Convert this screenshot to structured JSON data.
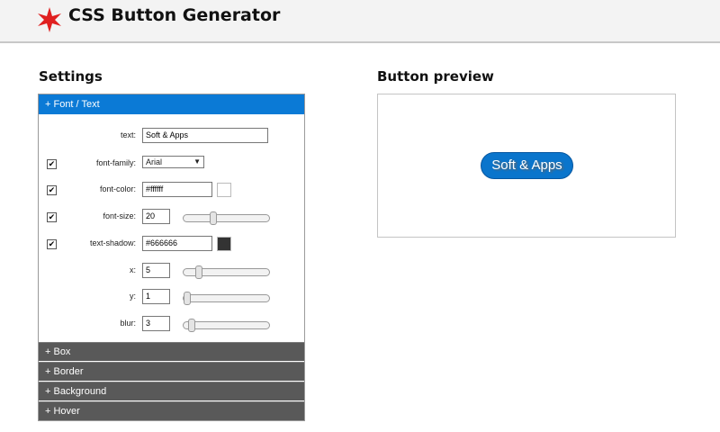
{
  "header": {
    "title": "CSS Button Generator",
    "logo_icon": "red-star-icon",
    "logo_color": "#e02020"
  },
  "settings": {
    "title": "Settings",
    "active_section": "+ Font / Text",
    "fields": {
      "text": {
        "label": "text:",
        "value": "Soft & Apps"
      },
      "font_family": {
        "label": "font-family:",
        "value": "Arial",
        "checked": true
      },
      "font_color": {
        "label": "font-color:",
        "value": "#ffffff",
        "checked": true,
        "swatch": "#ffffff"
      },
      "font_size": {
        "label": "font-size:",
        "value": "20",
        "checked": true,
        "slider": 0.33
      },
      "text_shadow": {
        "label": "text-shadow:",
        "value": "#666666",
        "checked": true,
        "swatch": "#333333"
      },
      "x": {
        "label": "x:",
        "value": "5",
        "slider": 0.15
      },
      "y": {
        "label": "y:",
        "value": "1",
        "slider": 0.0
      },
      "blur": {
        "label": "blur:",
        "value": "3",
        "slider": 0.06
      }
    },
    "sections": [
      "+ Box",
      "+ Border",
      "+ Background",
      "+ Hover"
    ]
  },
  "preview": {
    "title": "Button preview",
    "button_label": "Soft & Apps",
    "button_color": "#0a75cc"
  }
}
